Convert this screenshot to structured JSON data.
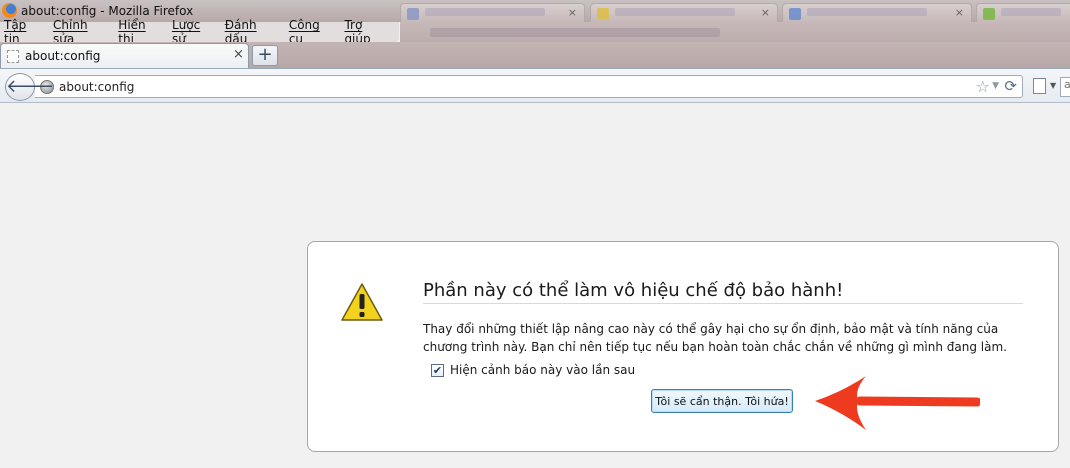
{
  "window": {
    "title": "about:config - Mozilla Firefox"
  },
  "menubar": {
    "items": [
      "Tập tin",
      "Chỉnh sửa",
      "Hiển thị",
      "Lược sử",
      "Đánh dấu",
      "Công cụ",
      "Trợ giúp"
    ]
  },
  "tabs": {
    "active_label": "about:config",
    "close_glyph": "×",
    "new_tab_glyph": "+"
  },
  "navbar": {
    "url": "about:config",
    "back_glyph": "🡐",
    "star_glyph": "☆",
    "dropmarker_glyph": "▼",
    "reload_glyph": "⟳",
    "search_partial": "a"
  },
  "warning": {
    "title": "Phần này có thể làm vô hiệu chế độ bảo hành!",
    "body": "Thay đổi những thiết lập nâng cao này có thể gây hại cho sự ổn định, bảo mật và tính năng của chương trình này. Bạn chỉ nên tiếp tục nếu bạn hoàn toàn chắc chắn về những gì mình đang làm.",
    "checkbox_label": "Hiện cảnh báo này vào lần sau",
    "checkbox_checked": true,
    "confirm_button": "Tôi sẽ cẩn thận. Tôi hứa!"
  },
  "colors": {
    "annotation_arrow": "#ee3b1f",
    "warning_icon": "#f2d21c"
  }
}
